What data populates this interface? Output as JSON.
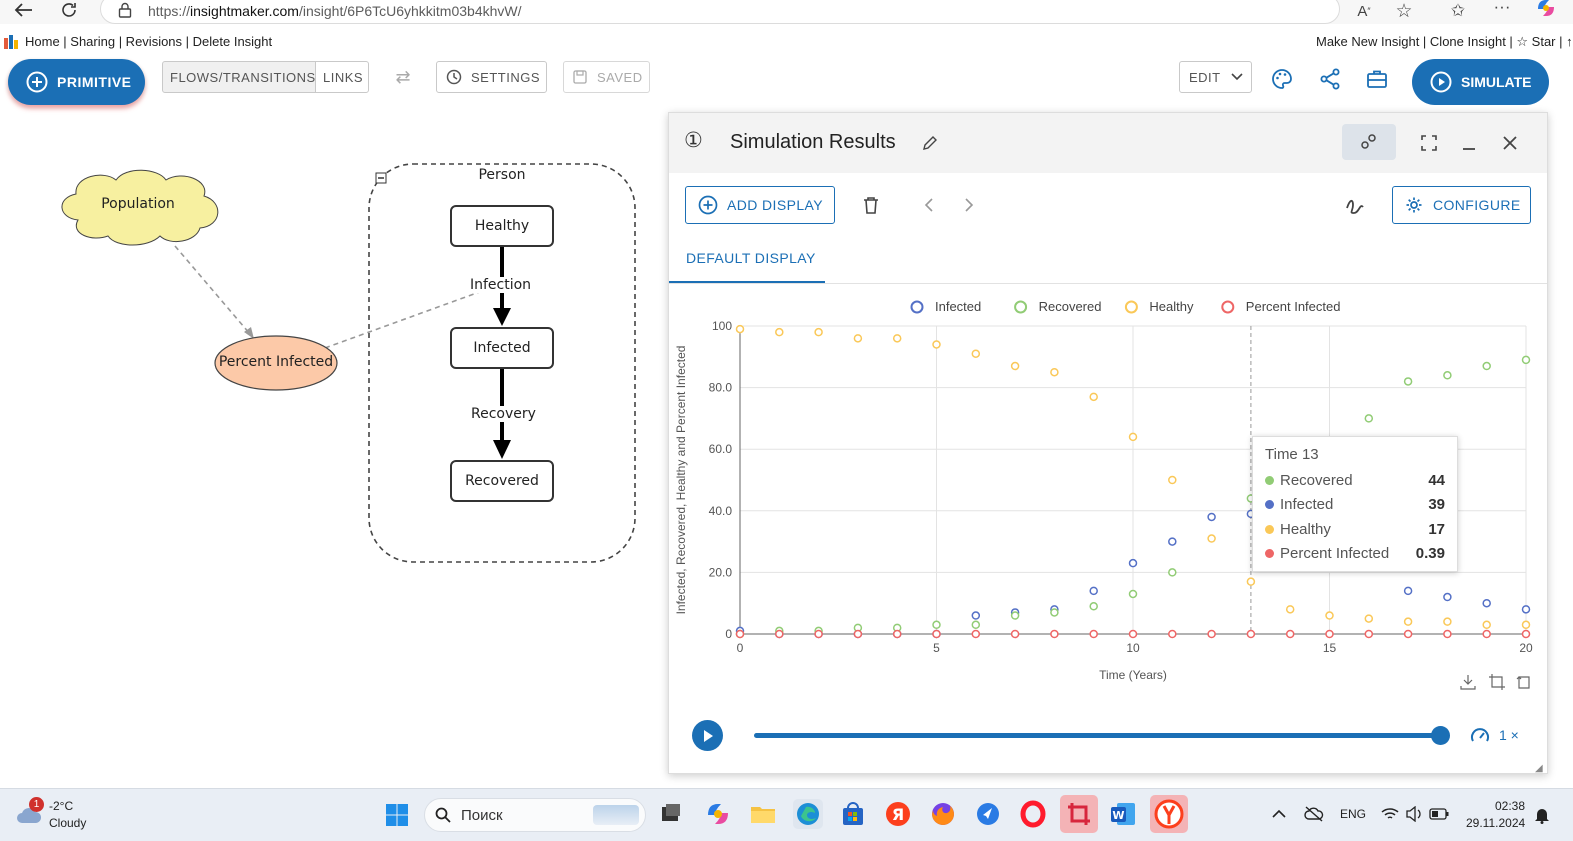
{
  "browser": {
    "url_prefix": "https://",
    "url_host": "insightmaker.com",
    "url_path": "/insight/6P6TcU6yhkkitm03b4khvW/"
  },
  "nav": {
    "left": "Home | Sharing | Revisions | Delete Insight",
    "right": "Make New Insight | Clone Insight | ☆ Star | ↑"
  },
  "toolbar": {
    "primitive": "PRIMITIVE",
    "flows": "FLOWS/TRANSITIONS",
    "links": "LINKS",
    "settings": "SETTINGS",
    "saved": "SAVED",
    "edit": "EDIT",
    "simulate": "SIMULATE"
  },
  "diagram": {
    "population": "Population",
    "percent_infected": "Percent Infected",
    "agent": "Person",
    "states": [
      "Healthy",
      "Infected",
      "Recovered"
    ],
    "transitions": [
      "Infection",
      "Recovery"
    ]
  },
  "panel": {
    "number": "①",
    "title": "Simulation Results",
    "add_display": "ADD DISPLAY",
    "configure": "CONFIGURE",
    "tab": "DEFAULT DISPLAY",
    "speed": "1 ×"
  },
  "chart_data": {
    "type": "scatter",
    "xlabel": "Time (Years)",
    "ylabel": "Infected, Recovered, Healthy and Percent Infected",
    "xlim": [
      0,
      20
    ],
    "ylim": [
      0,
      100
    ],
    "xticks": [
      0,
      5,
      10,
      15,
      20
    ],
    "yticks": [
      "0",
      "20.0",
      "40.0",
      "60.0",
      "80.0",
      "100"
    ],
    "grid": true,
    "legend": "top",
    "x": [
      0,
      1,
      2,
      3,
      4,
      5,
      6,
      7,
      8,
      9,
      10,
      11,
      12,
      13,
      14,
      15,
      16,
      17,
      18,
      19,
      20
    ],
    "series": [
      {
        "name": "Infected",
        "color": "#5470c6",
        "values": [
          1,
          0,
          0,
          0,
          0,
          0,
          6,
          7,
          8,
          14,
          23,
          30,
          38,
          39,
          null,
          null,
          null,
          14,
          12,
          10,
          8
        ]
      },
      {
        "name": "Recovered",
        "color": "#91cc75",
        "values": [
          0,
          1,
          1,
          2,
          2,
          3,
          3,
          6,
          7,
          9,
          13,
          20,
          null,
          44,
          null,
          null,
          70,
          82,
          84,
          87,
          89
        ]
      },
      {
        "name": "Healthy",
        "color": "#fac858",
        "values": [
          99,
          98,
          98,
          96,
          96,
          94,
          91,
          87,
          85,
          77,
          64,
          50,
          31,
          17,
          8,
          6,
          5,
          4,
          4,
          3,
          3
        ]
      },
      {
        "name": "Percent Infected",
        "color": "#ee6666",
        "values": [
          0,
          0,
          0,
          0,
          0,
          0,
          0,
          0,
          0,
          0,
          0,
          0,
          0,
          0,
          0,
          0,
          0,
          0,
          0,
          0,
          0
        ]
      }
    ],
    "hover": {
      "title": "Time 13",
      "rows": [
        {
          "name": "Recovered",
          "value": "44",
          "color": "#91cc75"
        },
        {
          "name": "Infected",
          "value": "39",
          "color": "#5470c6"
        },
        {
          "name": "Healthy",
          "value": "17",
          "color": "#fac858"
        },
        {
          "name": "Percent Infected",
          "value": "0.39",
          "color": "#ee6666"
        }
      ]
    }
  },
  "taskbar": {
    "weather_badge": "1",
    "temperature": "-2°C",
    "condition": "Cloudy",
    "search": "Поиск",
    "lang": "ENG",
    "time": "02:38",
    "date": "29.11.2024"
  },
  "colors": {
    "accent": "#1b6fb5",
    "population_fill": "#f7f0a0",
    "percent_fill": "#fcc9a8"
  }
}
